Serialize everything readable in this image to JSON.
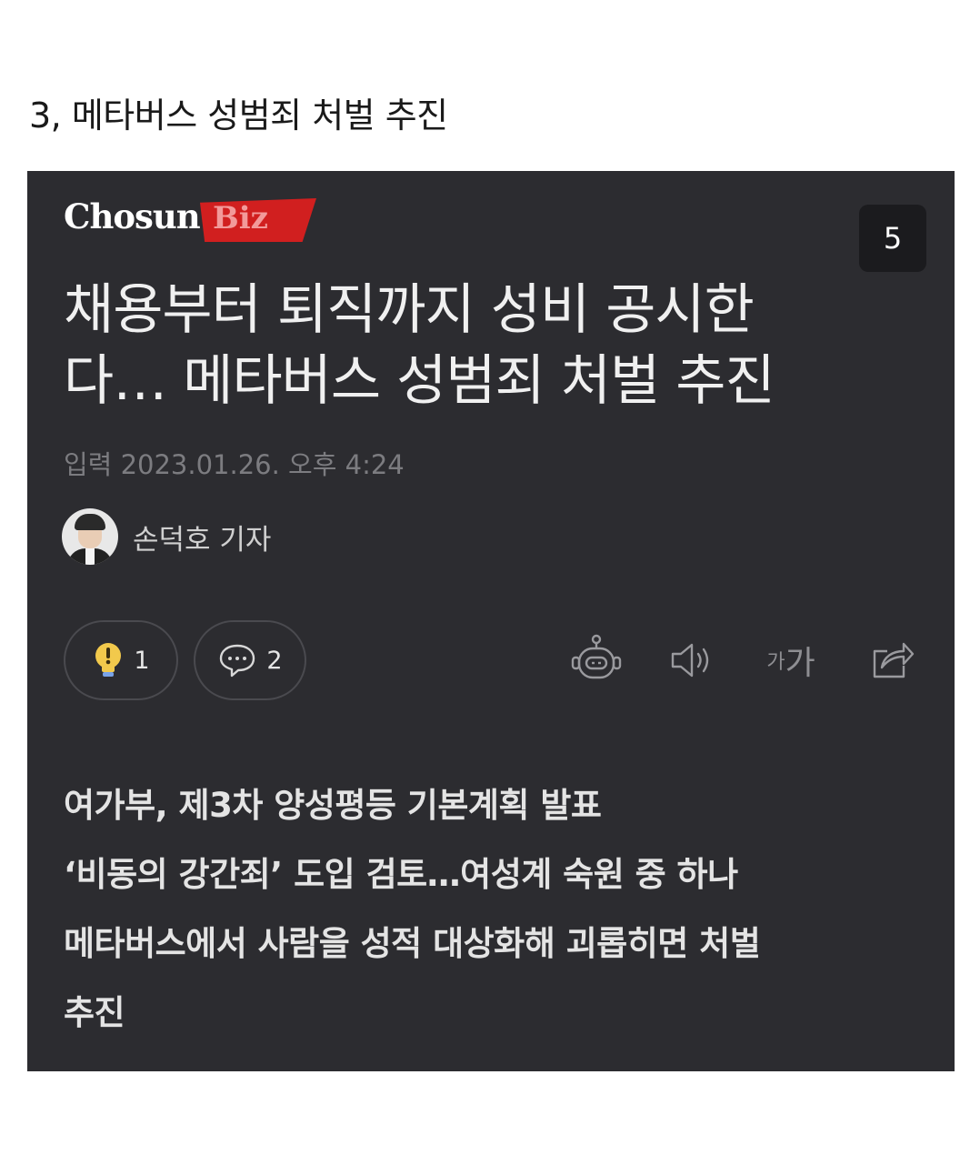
{
  "post": {
    "title": "3, 메타버스 성범죄 처벌 추진"
  },
  "card": {
    "logo": {
      "main": "Chosun",
      "accent": "Biz",
      "accent_color": "#d11f1f"
    },
    "page_badge": "5",
    "headline_lines": [
      "채용부터 퇴직까지 성비 공시한",
      "다… 메타버스 성범죄 처벌 추진"
    ],
    "date": "입력 2023.01.26. 오후 4:24",
    "author": {
      "name": "손덕호 기자"
    },
    "reactions": {
      "like_icon": "lightbulb-icon",
      "like_count": "1",
      "comment_icon": "comment-icon",
      "comment_count": "2"
    },
    "tools": {
      "robot_icon": "robot-icon",
      "speaker_icon": "speaker-icon",
      "font_small": "가",
      "font_large": "가",
      "share_icon": "share-icon"
    },
    "summary_lines": [
      "여가부, 제3차 양성평등 기본계획 발표",
      "‘비동의 강간죄’ 도입 검토…여성계 숙원 중 하나",
      "메타버스에서 사람을 성적 대상화해 괴롭히면 처벌",
      "추진"
    ],
    "colors": {
      "background": "#2c2c30",
      "text": "#f0f0f0",
      "muted": "#7c7c80",
      "like_bulb": "#f2c94c"
    }
  }
}
